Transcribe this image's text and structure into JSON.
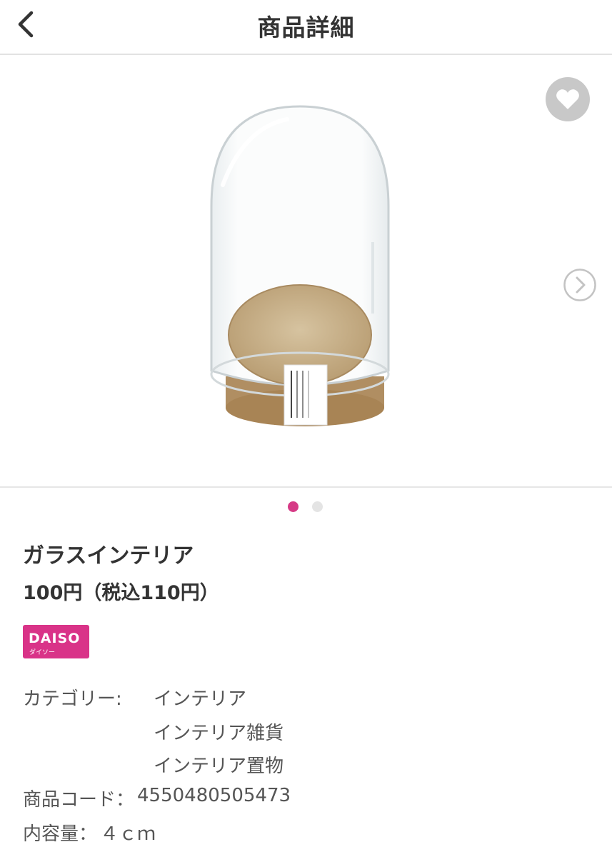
{
  "header": {
    "title": "商品詳細",
    "back_icon": "chevron-left-icon"
  },
  "gallery": {
    "favorite_icon": "heart-icon",
    "next_icon": "chevron-right-circle-icon",
    "page_count": 2,
    "current_page": 1,
    "indicator_active_color": "#d63a86"
  },
  "product": {
    "name": "ガラスインテリア",
    "price": "100円（税込110円）",
    "brand": {
      "logo_text": "DAISO",
      "logo_sub": "ダイソー",
      "color": "#d93388"
    },
    "category_label": "カテゴリー:",
    "categories": [
      "インテリア",
      "インテリア雑貨",
      "インテリア置物"
    ],
    "code_label": "商品コード：",
    "code": "4550480505473",
    "capacity_label": "内容量：",
    "capacity": "４ｃｍ"
  }
}
